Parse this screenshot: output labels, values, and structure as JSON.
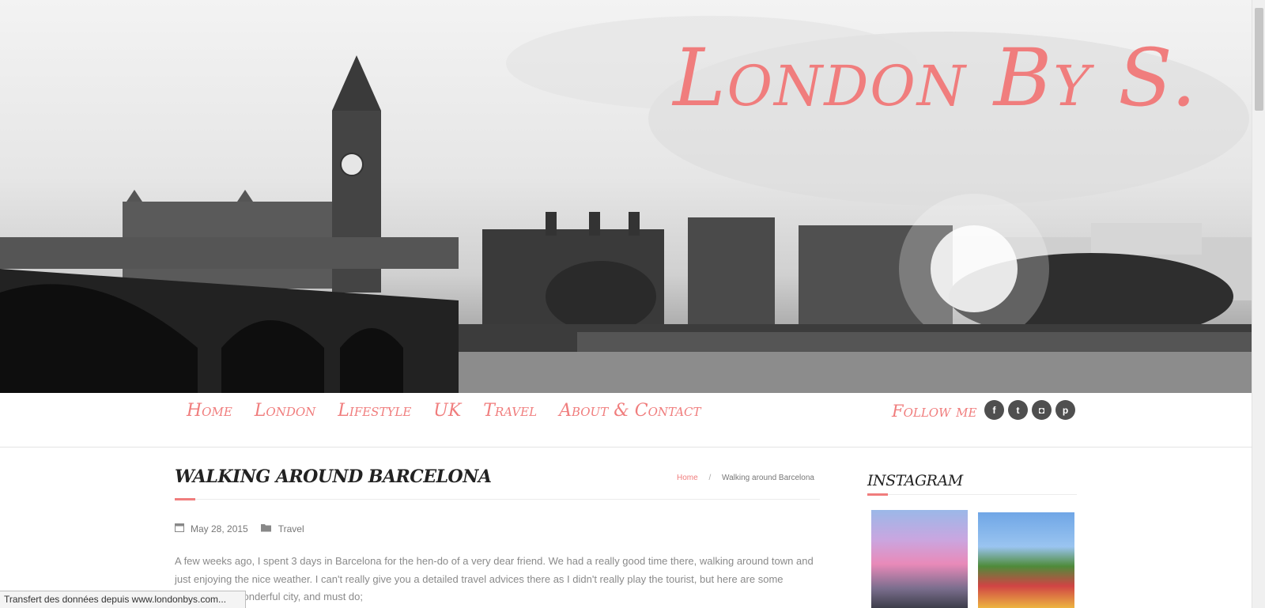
{
  "header": {
    "site_title": "London By S.",
    "title_color": "#f07d7d"
  },
  "nav": {
    "items": [
      {
        "label": "Home"
      },
      {
        "label": "London"
      },
      {
        "label": "Lifestyle"
      },
      {
        "label": "UK"
      },
      {
        "label": "Travel"
      },
      {
        "label": "About & Contact"
      }
    ],
    "follow_label": "Follow me",
    "socials": [
      {
        "icon": "facebook-icon",
        "glyph": "f"
      },
      {
        "icon": "twitter-icon",
        "glyph": "t"
      },
      {
        "icon": "instagram-icon",
        "glyph": "◘"
      },
      {
        "icon": "pinterest-icon",
        "glyph": "p"
      }
    ]
  },
  "post": {
    "title": "Walking around Barcelona",
    "breadcrumb": {
      "home": "Home",
      "separator": "/",
      "current": "Walking around Barcelona"
    },
    "date": "May 28, 2015",
    "category": "Travel",
    "body_line_1": "A few weeks ago, I spent 3 days in Barcelona for the hen-do of a very dear friend. We had a really good time there, walking around town and",
    "body_line_2": "just enjoying the nice weather. I can't really give you a detailed travel advices there as I didn't really play the tourist, but here are some",
    "body_line_3": "s wonderful city, and must do;"
  },
  "sidebar": {
    "instagram_title": "Instagram"
  },
  "status": {
    "text": "Transfert des données depuis www.londonbys.com..."
  },
  "colors": {
    "accent": "#f07d7d",
    "text": "#8a8a8a",
    "social_bg": "#4f4f4f"
  }
}
